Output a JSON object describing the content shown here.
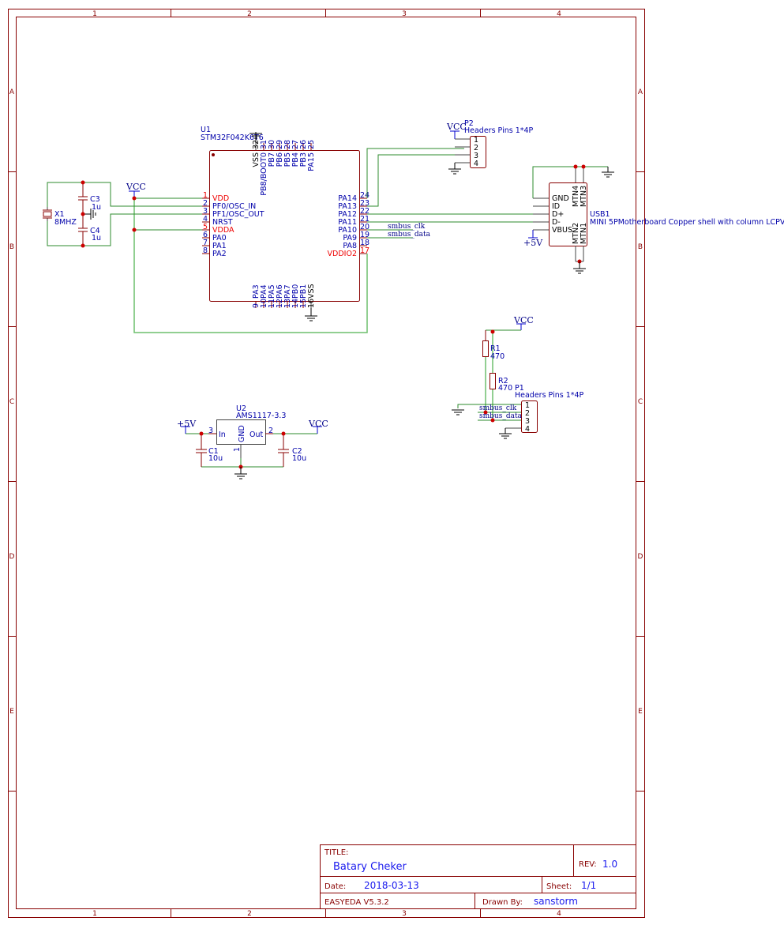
{
  "grid": {
    "columns": [
      "1",
      "2",
      "3",
      "4"
    ],
    "rows": [
      "A",
      "B",
      "C",
      "D",
      "E"
    ]
  },
  "title_block": {
    "title_label": "TITLE:",
    "title": "Batary Cheker",
    "rev_label": "REV:",
    "rev": "1.0",
    "date_label": "Date:",
    "date": "2018-03-13",
    "sheet_label": "Sheet:",
    "sheet": "1/1",
    "tool": "EASYEDA V5.3.2",
    "drawn_label": "Drawn By:",
    "drawn_by": "sanstorm"
  },
  "power_labels": {
    "vcc": "VCC",
    "p5v": "+5V"
  },
  "nets": {
    "smbus_clk": "smbus_clk",
    "smbus_data": "smbus_data"
  },
  "u1": {
    "ref": "U1",
    "value": "STM32F042K6T6",
    "left_pins": [
      [
        "1",
        "VDD",
        "red"
      ],
      [
        "2",
        "PF0/OSC_IN",
        "blue"
      ],
      [
        "3",
        "PF1/OSC_OUT",
        "blue"
      ],
      [
        "4",
        "NRST",
        "blue"
      ],
      [
        "5",
        "VDDA",
        "red"
      ],
      [
        "6",
        "PA0",
        "blue"
      ],
      [
        "7",
        "PA1",
        "blue"
      ],
      [
        "8",
        "PA2",
        "blue"
      ]
    ],
    "right_pins": [
      [
        "24",
        "PA14",
        "blue"
      ],
      [
        "23",
        "PA13",
        "blue"
      ],
      [
        "22",
        "PA12",
        "blue"
      ],
      [
        "21",
        "PA11",
        "blue"
      ],
      [
        "20",
        "PA10",
        "blue"
      ],
      [
        "19",
        "PA9",
        "blue"
      ],
      [
        "18",
        "PA8",
        "blue"
      ],
      [
        "17",
        "VDDIO2",
        "red"
      ]
    ],
    "top_pins": [
      [
        "32",
        "VSS",
        "black"
      ],
      [
        "31",
        "PB8/BOOT0",
        "blue"
      ],
      [
        "30",
        "PB7",
        "blue"
      ],
      [
        "29",
        "PB6",
        "blue"
      ],
      [
        "28",
        "PB5",
        "blue"
      ],
      [
        "27",
        "PB4",
        "blue"
      ],
      [
        "26",
        "PB3",
        "blue"
      ],
      [
        "25",
        "PA15",
        "blue"
      ]
    ],
    "bottom_pins": [
      [
        "9",
        "PA3",
        "blue"
      ],
      [
        "10",
        "PA4",
        "blue"
      ],
      [
        "11",
        "PA5",
        "blue"
      ],
      [
        "12",
        "PA6",
        "blue"
      ],
      [
        "13",
        "PA7",
        "blue"
      ],
      [
        "14",
        "PB0",
        "blue"
      ],
      [
        "15",
        "PB1",
        "blue"
      ],
      [
        "16",
        "VSS",
        "black"
      ]
    ]
  },
  "x1": {
    "ref": "X1",
    "value": "8MHZ"
  },
  "c3": {
    "ref": "C3",
    "value": "1u"
  },
  "c4": {
    "ref": "C4",
    "value": "1u"
  },
  "p2": {
    "ref": "P2",
    "value": "Headers  Pins 1*4P",
    "pins": [
      "1",
      "2",
      "3",
      "4"
    ]
  },
  "usb1": {
    "ref": "USB1",
    "value": "MINI 5PMotherboard Copper shell with column LCPVinyl",
    "left_pins": [
      "GND",
      "ID",
      "D+",
      "D-",
      "VBUS"
    ],
    "top_pins": [
      "MTN4",
      "MTN3"
    ],
    "bottom_pins": [
      "MTN2",
      "MTN1"
    ]
  },
  "r1": {
    "ref": "R1",
    "value": "470"
  },
  "r2": {
    "ref": "R2",
    "value": "470"
  },
  "p1": {
    "ref": "P1",
    "value": "Headers  Pins 1*4P",
    "pins": [
      "1",
      "2",
      "3",
      "4"
    ]
  },
  "u2": {
    "ref": "U2",
    "value": "AMS1117-3.3",
    "pin_in": "In",
    "pin_out": "Out",
    "pin_gnd": "GND",
    "num_in": "3",
    "num_out": "2",
    "num_gnd": "1"
  },
  "c1": {
    "ref": "C1",
    "value": "10u"
  },
  "c2": {
    "ref": "C2",
    "value": "10u"
  },
  "colors": {
    "frame": "#880000",
    "wire": "#2e8b2e",
    "junction": "#cc0000",
    "pin_name": "#0000aa",
    "power_pin": "#ee0000"
  }
}
